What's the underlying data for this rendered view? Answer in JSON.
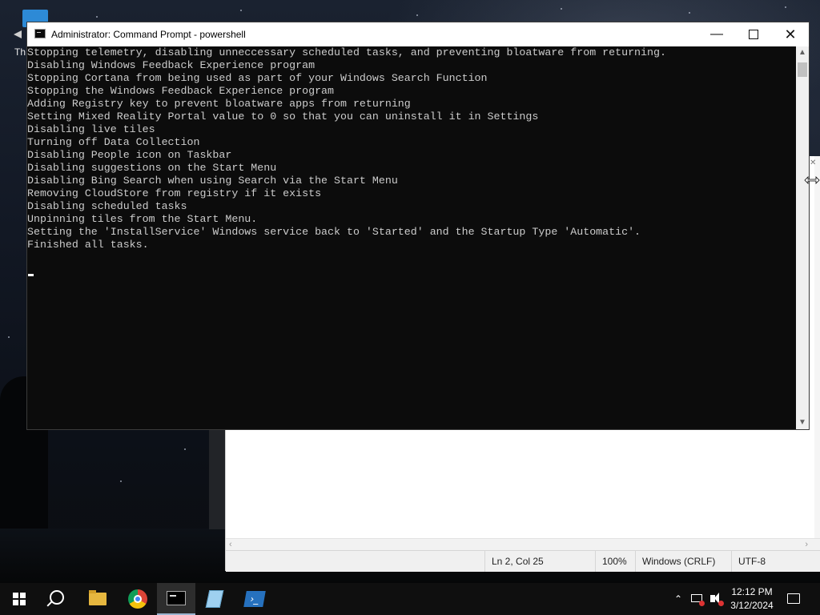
{
  "desktop": {
    "icon_caption": "Th"
  },
  "cmd_window": {
    "title": "Administrator: Command Prompt - powershell",
    "lines": [
      "Stopping telemetry, disabling unneccessary scheduled tasks, and preventing bloatware from returning.",
      "Disabling Windows Feedback Experience program",
      "Stopping Cortana from being used as part of your Windows Search Function",
      "Stopping the Windows Feedback Experience program",
      "Adding Registry key to prevent bloatware apps from returning",
      "Setting Mixed Reality Portal value to 0 so that you can uninstall it in Settings",
      "Disabling live tiles",
      "Turning off Data Collection",
      "Disabling People icon on Taskbar",
      "Disabling suggestions on the Start Menu",
      "Disabling Bing Search when using Search via the Start Menu",
      "Removing CloudStore from registry if it exists",
      "Disabling scheduled tasks",
      "Unpinning tiles from the Start Menu.",
      "Setting the 'InstallService' Windows service back to 'Started' and the Startup Type 'Automatic'.",
      "Finished all tasks."
    ]
  },
  "notepad_window": {
    "status": {
      "position": "Ln 2, Col 25",
      "zoom": "100%",
      "line_ending": "Windows (CRLF)",
      "encoding": "UTF-8"
    }
  },
  "taskbar": {
    "clock_time": "12:12 PM",
    "clock_date": "3/12/2024",
    "apps": [
      "start-icon",
      "search-icon",
      "file-explorer-icon",
      "chrome-icon",
      "command-prompt-icon",
      "notepad-icon",
      "powershell-icon"
    ]
  },
  "colors": {
    "console_bg": "#0c0c0c",
    "console_text": "#cccccc",
    "taskbar_bg": "#0f0f0f"
  }
}
